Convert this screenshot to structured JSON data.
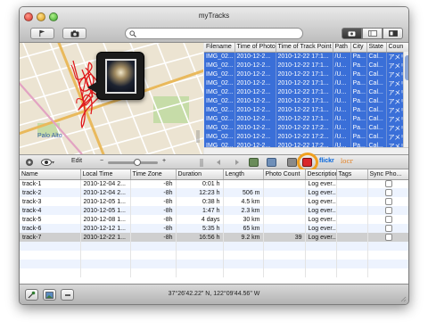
{
  "window": {
    "title": "myTracks"
  },
  "toolbar": {
    "search": {
      "value": "",
      "placeholder": ""
    }
  },
  "map": {
    "labels": {
      "palo_alto": "Palo Alto"
    },
    "colors": {
      "track": "#e0191b",
      "road_major": "#e9b95c",
      "road_minor": "#ffffff",
      "park": "#b8d49b"
    }
  },
  "photo_table": {
    "columns": [
      "Filename",
      "Time of Photo",
      "Time of Track Point",
      "Path",
      "City",
      "State",
      "Coun"
    ],
    "rows": [
      [
        "IMG_02...",
        "2010-12-2...",
        "2010-12-22 17:1...",
        "/U...",
        "Pa...",
        "Cal...",
        "アメリ"
      ],
      [
        "IMG_02...",
        "2010-12-2...",
        "2010-12-22 17:1...",
        "/U...",
        "Pa...",
        "Cal...",
        "アメリ"
      ],
      [
        "IMG_02...",
        "2010-12-2...",
        "2010-12-22 17:1...",
        "/U...",
        "Pa...",
        "Cal...",
        "アメリ"
      ],
      [
        "IMG_02...",
        "2010-12-2...",
        "2010-12-22 17:1...",
        "/U...",
        "Pa...",
        "Cal...",
        "アメリ"
      ],
      [
        "IMG_02...",
        "2010-12-2...",
        "2010-12-22 17:1...",
        "/U...",
        "Pa...",
        "Cal...",
        "アメリ"
      ],
      [
        "IMG_02...",
        "2010-12-2...",
        "2010-12-22 17:1...",
        "/U...",
        "Pa...",
        "Cal...",
        "アメリ"
      ],
      [
        "IMG_02...",
        "2010-12-2...",
        "2010-12-22 17:1...",
        "/U...",
        "Pa...",
        "Cal...",
        "アメリ"
      ],
      [
        "IMG_02...",
        "2010-12-2...",
        "2010-12-22 17:1...",
        "/U...",
        "Pa...",
        "Cal...",
        "アメリ"
      ],
      [
        "IMG_02...",
        "2010-12-2...",
        "2010-12-22 17:2...",
        "/U...",
        "Pa...",
        "Cal...",
        "アメリ"
      ],
      [
        "IMG_02...",
        "2010-12-2...",
        "2010-12-22 17:2...",
        "/U...",
        "Pa...",
        "Cal...",
        "アメリ"
      ],
      [
        "IMG_02...",
        "2010-12-2...",
        "2010-12-22 17:2...",
        "/U...",
        "Pa...",
        "Cal...",
        "アメリ"
      ]
    ]
  },
  "midbar": {
    "edit_label": "Edit",
    "minus_label": "−",
    "plus_label": "+",
    "flickr_label": "flickr",
    "locr_label": "locr"
  },
  "tracks_table": {
    "columns": [
      "Name",
      "Local Time",
      "Time Zone",
      "Duration",
      "Length",
      "Photo Count",
      "Description",
      "Tags",
      "Sync Pho..."
    ],
    "rows": [
      {
        "name": "track-1",
        "local_time": "2010-12-04 2...",
        "time_zone": "-8h",
        "duration": "0:01 h",
        "length": "",
        "photo_count": "",
        "description": "Log ever...",
        "tags": ""
      },
      {
        "name": "track-2",
        "local_time": "2010-12-04 2...",
        "time_zone": "-8h",
        "duration": "12:23 h",
        "length": "506 m",
        "photo_count": "",
        "description": "Log ever...",
        "tags": ""
      },
      {
        "name": "track-3",
        "local_time": "2010-12-05 1...",
        "time_zone": "-8h",
        "duration": "0:38 h",
        "length": "4.5 km",
        "photo_count": "",
        "description": "Log ever...",
        "tags": ""
      },
      {
        "name": "track-4",
        "local_time": "2010-12-05 1...",
        "time_zone": "-8h",
        "duration": "1:47 h",
        "length": "2.3 km",
        "photo_count": "",
        "description": "Log ever...",
        "tags": ""
      },
      {
        "name": "track-5",
        "local_time": "2010-12-08 1...",
        "time_zone": "-8h",
        "duration": "4 days",
        "length": "30 km",
        "photo_count": "",
        "description": "Log ever...",
        "tags": ""
      },
      {
        "name": "track-6",
        "local_time": "2010-12-12 1...",
        "time_zone": "-8h",
        "duration": "5:35 h",
        "length": "65 km",
        "photo_count": "",
        "description": "Log ever...",
        "tags": ""
      },
      {
        "name": "track-7",
        "local_time": "2010-12-22 1...",
        "time_zone": "-8h",
        "duration": "16:56 h",
        "length": "9.2 km",
        "photo_count": "39",
        "description": "Log ever...",
        "tags": ""
      }
    ]
  },
  "status": {
    "coordinates": "37°26'42.22\" N, 122°09'44.56\" W"
  },
  "colors": {
    "selection_blue": "#3a6fd8",
    "highlight_ring": "#f0a020"
  }
}
